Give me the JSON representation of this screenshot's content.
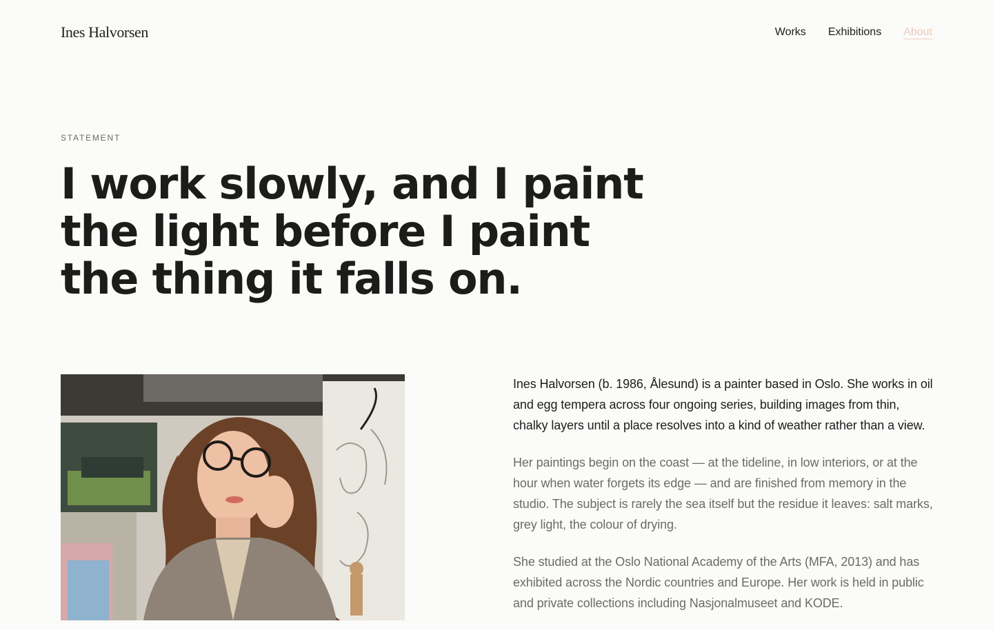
{
  "site": {
    "brand": "Ines Halvorsen"
  },
  "nav": {
    "items": [
      {
        "label": "Works",
        "active": false
      },
      {
        "label": "Exhibitions",
        "active": false
      },
      {
        "label": "About",
        "active": true
      }
    ]
  },
  "statement": {
    "kicker": "STATEMENT",
    "headline": "I work slowly, and I paint the light before I paint the thing it falls on."
  },
  "portrait": {
    "alt": "Portrait of Ines Halvorsen in her studio"
  },
  "bio": {
    "paragraphs": [
      "Ines Halvorsen (b. 1986, Ålesund) is a painter based in Oslo. She works in oil and egg tempera across four ongoing series, building images from thin, chalky layers until a place resolves into a kind of weather rather than a view.",
      "Her paintings begin on the coast — at the tideline, in low interiors, or at the hour when water forgets its edge — and are finished from memory in the studio. The subject is rarely the sea itself but the residue it leaves: salt marks, grey light, the colour of drying.",
      "She studied at the Oslo National Academy of the Arts (MFA, 2013) and has exhibited across the Nordic countries and Europe. Her work is held in public and private collections including Nasjonalmuseet and KODE."
    ]
  },
  "colors": {
    "background": "#fbfbf9",
    "text": "#1d1d1b",
    "muted_text": "#6b6b67",
    "active_nav": "#e9cdbd"
  }
}
